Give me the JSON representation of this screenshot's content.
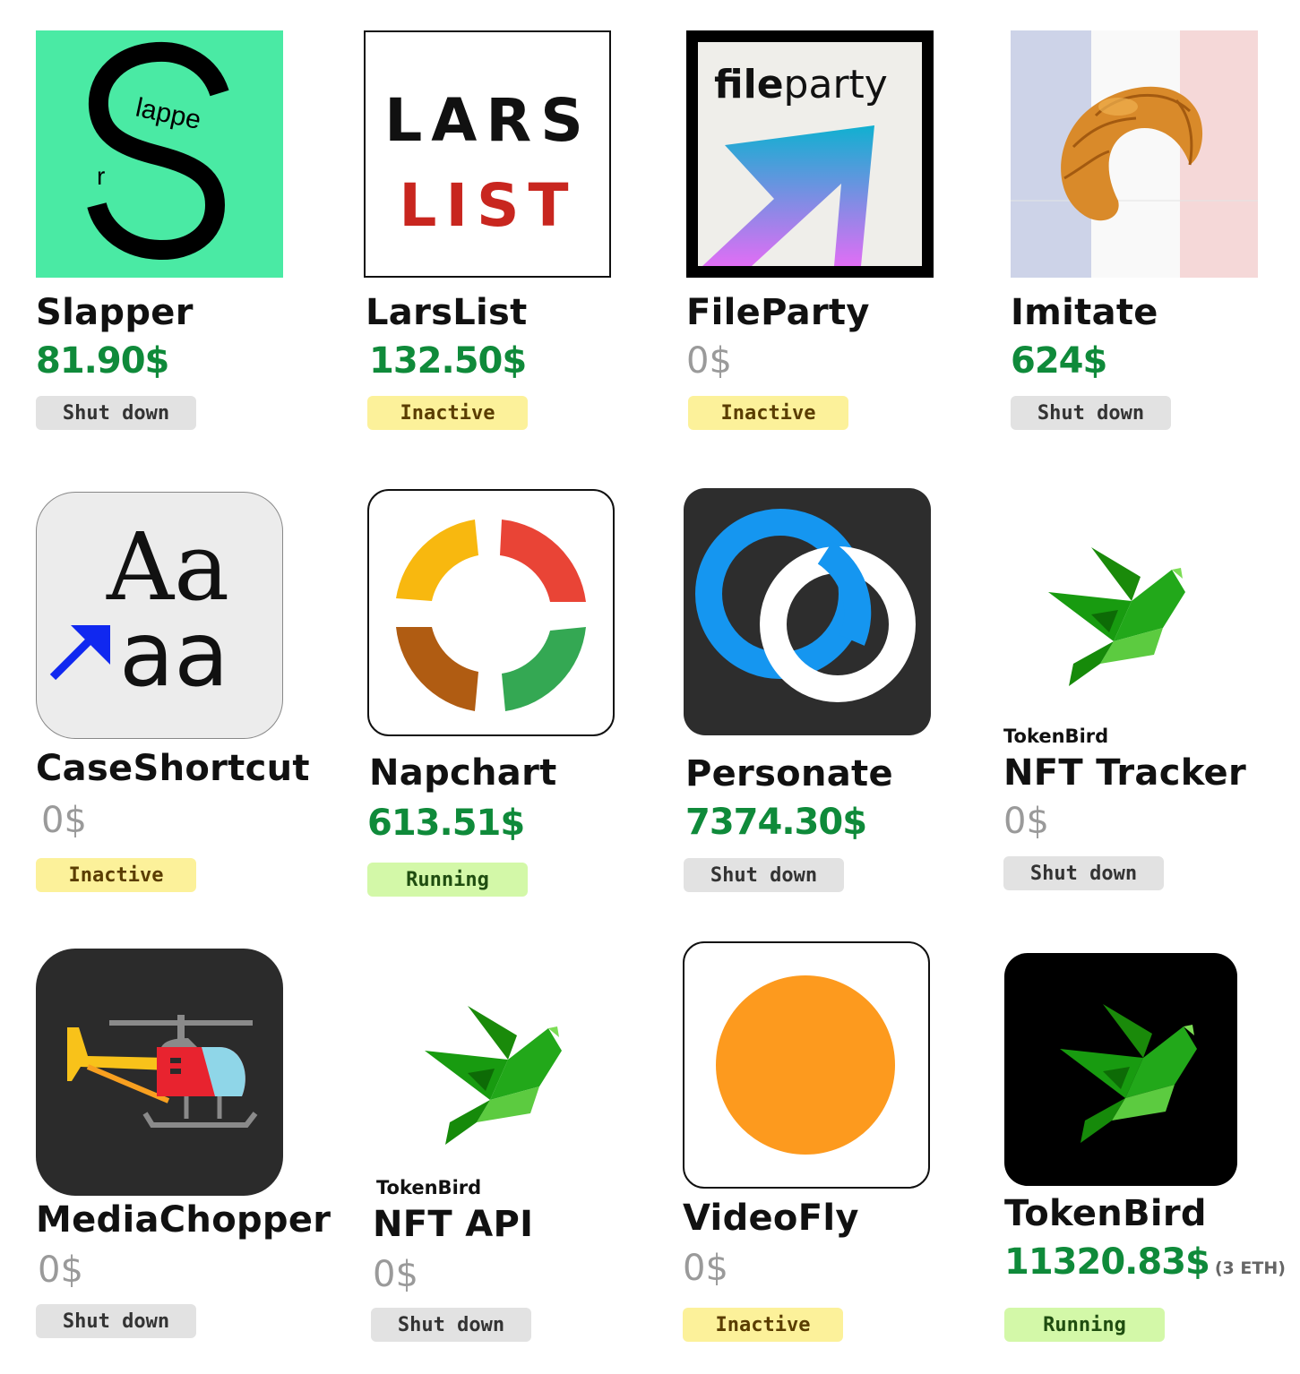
{
  "projects": [
    {
      "name": "Slapper",
      "price": "81.90$",
      "status": "Shut down",
      "logo_text": "Slapper"
    },
    {
      "name": "LarsList",
      "price": "132.50$",
      "status": "Inactive",
      "logo_line1": "LARS",
      "logo_line2": "LIST"
    },
    {
      "name": "FileParty",
      "price": "0$",
      "status": "Inactive",
      "logo_text_bold": "file",
      "logo_text_light": "party"
    },
    {
      "name": "Imitate",
      "price": "624$",
      "status": "Shut down"
    },
    {
      "name": "CaseShortcut",
      "price": "0$",
      "status": "Inactive",
      "logo_upper": "Aa",
      "logo_lower": "aa"
    },
    {
      "name": "Napchart",
      "price": "613.51$",
      "status": "Running"
    },
    {
      "name": "Personate",
      "price": "7374.30$",
      "status": "Shut down"
    },
    {
      "name": "NFT Tracker",
      "brand": "TokenBird",
      "price": "0$",
      "status": "Shut down"
    },
    {
      "name": "MediaChopper",
      "price": "0$",
      "status": "Shut down"
    },
    {
      "name": "NFT API",
      "brand": "TokenBird",
      "price": "0$",
      "status": "Shut down"
    },
    {
      "name": "VideoFly",
      "price": "0$",
      "status": "Inactive"
    },
    {
      "name": "TokenBird",
      "price": "11320.83$",
      "price_note": "(3 ETH)",
      "status": "Running"
    }
  ],
  "colors": {
    "price_positive": "#0f8a3a",
    "price_zero": "#9a9a9a",
    "badge_shut_down": "#e2e2e2",
    "badge_inactive": "#fcf19a",
    "badge_running": "#d3f8a8"
  },
  "icons": [
    "slapper-logo",
    "larslist-logo",
    "fileparty-logo",
    "croissant-icon",
    "caseshortcut-logo",
    "napchart-logo",
    "personate-logo",
    "bird-icon",
    "helicopter-icon",
    "bird-icon",
    "orange-circle-icon",
    "bird-icon"
  ]
}
